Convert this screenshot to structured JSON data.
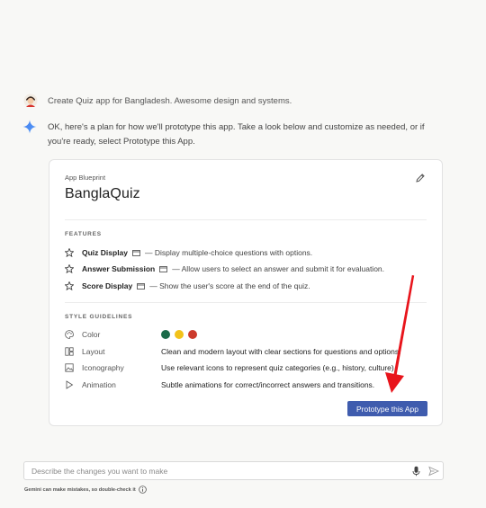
{
  "conversation": {
    "user_prompt": "Create Quiz app for Bangladesh. Awesome design and systems.",
    "ai_reply": "OK, here's a plan for how we'll prototype this app. Take a look below and customize as needed, or if you're ready, select Prototype this App."
  },
  "blueprint": {
    "eyebrow": "App Blueprint",
    "title": "BanglaQuiz",
    "features_label": "FEATURES",
    "features": [
      {
        "name": "Quiz Display",
        "desc": "— Display multiple-choice questions with options."
      },
      {
        "name": "Answer Submission",
        "desc": "— Allow users to select an answer and submit it for evaluation."
      },
      {
        "name": "Score Display",
        "desc": "— Show the user's score at the end of the quiz."
      }
    ],
    "style_label": "STYLE GUIDELINES",
    "style": {
      "color_label": "Color",
      "colors": [
        "#1b6b4a",
        "#f2c21a",
        "#cc3a2c"
      ],
      "layout_label": "Layout",
      "layout_value": "Clean and modern layout with clear sections for questions and options.",
      "iconography_label": "Iconography",
      "iconography_value": "Use relevant icons to represent quiz categories (e.g., history, culture).",
      "animation_label": "Animation",
      "animation_value": "Subtle animations for correct/incorrect answers and transitions."
    },
    "prototype_button": "Prototype this App"
  },
  "composer": {
    "placeholder": "Describe the changes you want to make",
    "disclaimer": "Gemini can make mistakes, so double-check it"
  },
  "icons": {
    "user_avatar": "user-avatar-icon",
    "gemini": "gemini-sparkle-icon",
    "edit": "pencil-icon",
    "feature": "star-icon",
    "window": "window-icon",
    "palette": "palette-icon",
    "layout": "layout-icon",
    "iconography": "image-icon",
    "animation": "play-icon",
    "mic": "mic-icon",
    "send": "send-icon",
    "info": "info-icon"
  },
  "colors": {
    "accent": "#3f5cae",
    "annotation_arrow": "#e8141b"
  }
}
